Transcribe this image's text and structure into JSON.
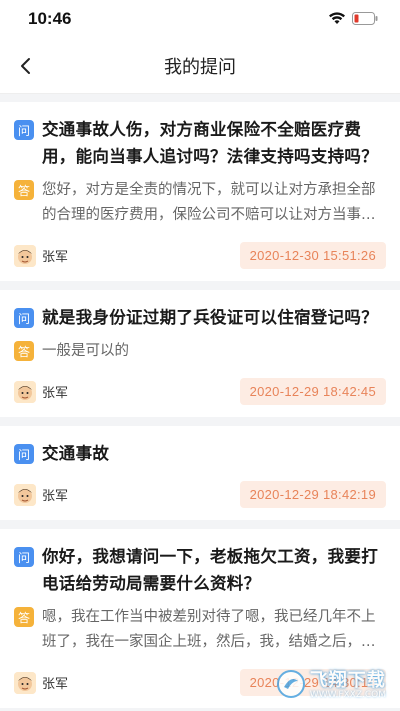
{
  "status_bar": {
    "time": "10:46"
  },
  "nav": {
    "title": "我的提问"
  },
  "tags": {
    "question": "问",
    "answer": "答"
  },
  "questions": [
    {
      "question": "交通事故人伤，对方商业保险不全赔医疗费用，能向当事人追讨吗？法律支持吗支持吗？",
      "answer": "您好，对方是全责的情况下，就可以让对方承担全部的合理的医疗费用，保险公司不赔可以让对方当事人承担",
      "author": "张军",
      "timestamp": "2020-12-30 15:51:26"
    },
    {
      "question": "就是我身份证过期了兵役证可以住宿登记吗？",
      "answer": "一般是可以的",
      "author": "张军",
      "timestamp": "2020-12-29 18:42:45"
    },
    {
      "question": "交通事故",
      "answer": "",
      "author": "张军",
      "timestamp": "2020-12-29 18:42:19"
    },
    {
      "question": "你好，我想请问一下，老板拖欠工资，我要打电话给劳动局需要什么资料？",
      "answer": "嗯，我在工作当中被差别对待了嗯，我已经几年不上班了，我在一家国企上班，然后，我，结婚之后，我就被差别对待了",
      "author": "张军",
      "timestamp": "2020-12-29 14:30:14"
    }
  ],
  "watermark": {
    "text": "飞翔下载",
    "sub": "WWW.FXXZ.COM"
  },
  "colors": {
    "question_tag": "#4a90f0",
    "answer_tag": "#f5b23a",
    "time_badge_bg": "#fdece3",
    "time_badge_text": "#e8845a"
  }
}
